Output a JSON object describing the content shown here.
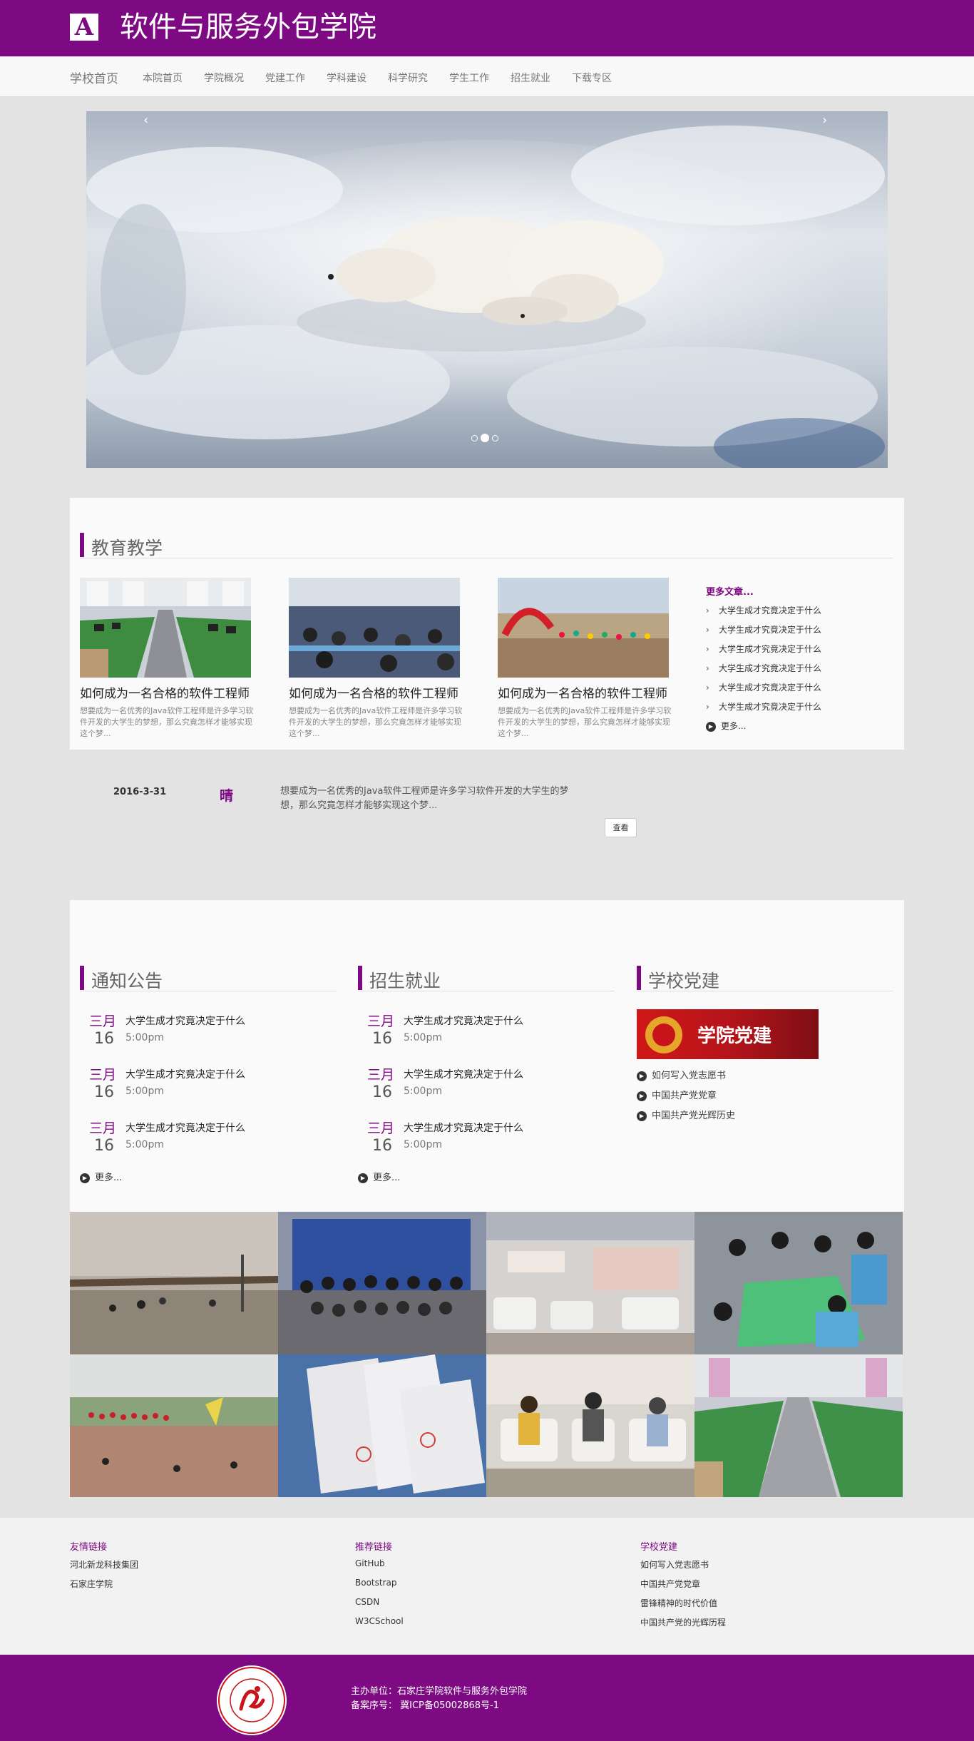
{
  "header": {
    "logo_letter": "A",
    "title": "软件与服务外包学院"
  },
  "nav": {
    "brand": "学校首页",
    "items": [
      "本院首页",
      "学院概况",
      "党建工作",
      "学科建设",
      "科学研究",
      "学生工作",
      "招生就业",
      "下载专区"
    ]
  },
  "carousel": {
    "prev": "‹",
    "next": "›",
    "slide_count": 3,
    "active_slide": 2
  },
  "education": {
    "section_title": "教育教学",
    "cards": [
      {
        "title": "如何成为一名合格的软件工程师",
        "desc": "想要成为一名优秀的Java软件工程师是许多学习软件开发的大学生的梦想，那么究竟怎样才能够实现这个梦..."
      },
      {
        "title": "如何成为一名合格的软件工程师",
        "desc": "想要成为一名优秀的Java软件工程师是许多学习软件开发的大学生的梦想，那么究竟怎样才能够实现这个梦..."
      },
      {
        "title": "如何成为一名合格的软件工程师",
        "desc": "想要成为一名优秀的Java软件工程师是许多学习软件开发的大学生的梦想，那么究竟怎样才能够实现这个梦..."
      }
    ],
    "more_heading": "更多文章...",
    "articles": [
      "大学生成才究竟决定于什么",
      "大学生成才究竟决定于什么",
      "大学生成才究竟决定于什么",
      "大学生成才究竟决定于什么",
      "大学生成才究竟决定于什么",
      "大学生成才究竟决定于什么"
    ],
    "more_label": "更多..."
  },
  "weather_strip": {
    "date": "2016-3-31",
    "weather": "晴",
    "desc": "想要成为一名优秀的Java软件工程师是许多学习软件开发的大学生的梦想，那么究竟怎样才能够实现这个梦...",
    "button": "查看"
  },
  "notices": {
    "title": "通知公告",
    "items": [
      {
        "month": "三月",
        "day": "16",
        "title": "大学生成才究竟决定于什么",
        "time": "5:00pm"
      },
      {
        "month": "三月",
        "day": "16",
        "title": "大学生成才究竟决定于什么",
        "time": "5:00pm"
      },
      {
        "month": "三月",
        "day": "16",
        "title": "大学生成才究竟决定于什么",
        "time": "5:00pm"
      }
    ],
    "more": "更多..."
  },
  "admissions": {
    "title": "招生就业",
    "items": [
      {
        "month": "三月",
        "day": "16",
        "title": "大学生成才究竟决定于什么",
        "time": "5:00pm"
      },
      {
        "month": "三月",
        "day": "16",
        "title": "大学生成才究竟决定于什么",
        "time": "5:00pm"
      },
      {
        "month": "三月",
        "day": "16",
        "title": "大学生成才究竟决定于什么",
        "time": "5:00pm"
      }
    ],
    "more": "更多..."
  },
  "party": {
    "title": "学校党建",
    "banner_text": "学院党建",
    "items": [
      "如何写入党志愿书",
      "中国共产党党章",
      "中国共产党光辉历史"
    ]
  },
  "footer": {
    "columns": [
      {
        "title": "友情链接",
        "items": [
          "河北新龙科技集团",
          "石家庄学院"
        ]
      },
      {
        "title": "推荐链接",
        "items": [
          "GitHub",
          "Bootstrap",
          "CSDN",
          "W3CSchool"
        ]
      },
      {
        "title": "学校党建",
        "items": [
          "如何写入党志愿书",
          "中国共产党党章",
          "雷锋精神的时代价值",
          "中国共产党的光辉历程"
        ]
      }
    ],
    "host": "主办单位：石家庄学院软件与服务外包学院",
    "icp": "备案序号：  冀ICP备05002868号-1",
    "seal_text": "石家庄学院",
    "seal_en": "SHIJIAZHUANG UNIVERSITY"
  },
  "colors": {
    "brand": "#7d0a83",
    "page_bg": "#e3e3e3",
    "panel_bg": "#fafafa"
  }
}
